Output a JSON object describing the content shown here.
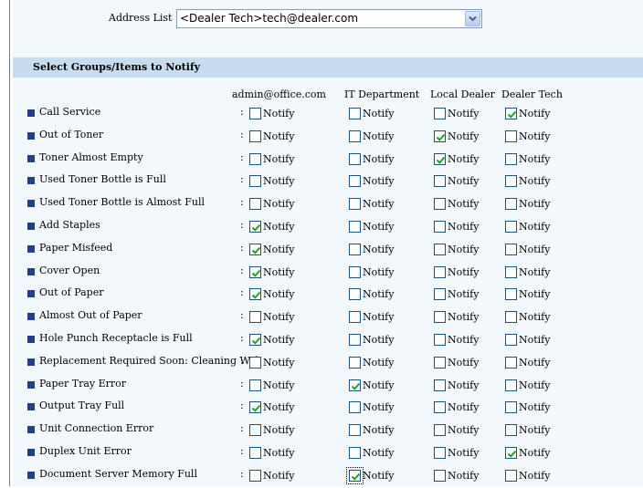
{
  "address_list": {
    "label": "Address List :",
    "selected": "<Dealer Tech>tech@dealer.com"
  },
  "section_title": "Select Groups/Items to Notify",
  "columns": [
    "admin@office.com",
    "IT Department",
    "Local Dealer",
    "Dealer Tech"
  ],
  "notify_label": "Notify",
  "separator": ":",
  "items": [
    {
      "label": "Call Service",
      "checks": [
        false,
        false,
        false,
        true
      ]
    },
    {
      "label": "Out of Toner",
      "checks": [
        false,
        false,
        true,
        false
      ]
    },
    {
      "label": "Toner Almost Empty",
      "checks": [
        false,
        false,
        true,
        false
      ]
    },
    {
      "label": "Used Toner Bottle is Full",
      "checks": [
        false,
        false,
        false,
        false
      ]
    },
    {
      "label": "Used Toner Bottle is Almost Full",
      "checks": [
        false,
        false,
        false,
        false
      ]
    },
    {
      "label": "Add Staples",
      "checks": [
        true,
        false,
        false,
        false
      ]
    },
    {
      "label": "Paper Misfeed",
      "checks": [
        true,
        false,
        false,
        false
      ]
    },
    {
      "label": "Cover Open",
      "checks": [
        true,
        false,
        false,
        false
      ]
    },
    {
      "label": "Out of Paper",
      "checks": [
        true,
        false,
        false,
        false
      ]
    },
    {
      "label": "Almost Out of Paper",
      "checks": [
        false,
        false,
        false,
        false
      ]
    },
    {
      "label": "Hole Punch Receptacle is Full",
      "checks": [
        true,
        false,
        false,
        false
      ]
    },
    {
      "label": "Replacement Required Soon: Cleaning Web",
      "checks": [
        false,
        false,
        false,
        false
      ]
    },
    {
      "label": "Paper Tray Error",
      "checks": [
        false,
        true,
        false,
        false
      ]
    },
    {
      "label": "Output Tray Full",
      "checks": [
        true,
        false,
        false,
        false
      ]
    },
    {
      "label": "Unit Connection Error",
      "checks": [
        false,
        false,
        false,
        false
      ]
    },
    {
      "label": "Duplex Unit Error",
      "checks": [
        false,
        false,
        false,
        true
      ]
    },
    {
      "label": "Document Server Memory Full",
      "checks": [
        false,
        true,
        false,
        false
      ]
    }
  ],
  "colors": {
    "panel_bg": "#f3f8fc",
    "section_bar": "#c8dcf0",
    "bullet": "#1f3f86",
    "checkbox_border": "#1c5180",
    "checkmark": "#21a121"
  },
  "icons": {
    "bullet": "square-bullet-icon",
    "checkmark": "checkmark-icon",
    "dropdown": "chevron-down-icon"
  }
}
